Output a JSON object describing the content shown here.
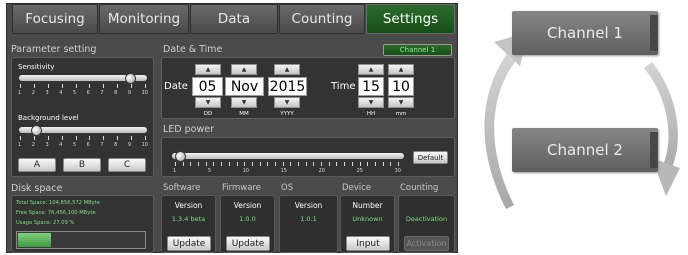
{
  "tabs": [
    {
      "label": "Focusing"
    },
    {
      "label": "Monitoring"
    },
    {
      "label": "Data"
    },
    {
      "label": "Counting"
    },
    {
      "label": "Settings",
      "active": true
    }
  ],
  "parameter": {
    "title": "Parameter setting",
    "sensitivity_label": "Sensitivity",
    "sensitivity_value": 9,
    "background_label": "Background level",
    "background_value": 2,
    "scale": [
      "1",
      "2",
      "3",
      "4",
      "5",
      "6",
      "7",
      "8",
      "9",
      "10"
    ],
    "buttons": [
      "A",
      "B",
      "C"
    ]
  },
  "datetime": {
    "title": "Date & Time",
    "channel_badge": "Channel 1",
    "date_label": "Date",
    "day": "05",
    "month": "Nov",
    "year": "2015",
    "day_sub": "DD",
    "month_sub": "MM",
    "year_sub": "YYYY",
    "time_label": "Time",
    "hour": "15",
    "minute": "10",
    "hour_sub": "HH",
    "minute_sub": "mm",
    "up_arrow": "▲",
    "down_arrow": "▼"
  },
  "led": {
    "title": "LED power",
    "value": 1,
    "scale": [
      "1",
      "5",
      "10",
      "15",
      "20",
      "25",
      "30"
    ],
    "default_button": "Default"
  },
  "disk": {
    "title": "Disk space",
    "total": "Total Space: 104,856,572 MByte",
    "free": "Free Space: 76,456,100 MByte",
    "usage": "Usage Space: 27.09 %",
    "usage_fraction": 0.27
  },
  "software": {
    "title": "Software",
    "label": "Version",
    "value": "1.3.4 beta",
    "button": "Update"
  },
  "firmware": {
    "title": "Firmware",
    "label": "Version",
    "value": "1.0.0",
    "button": "Update"
  },
  "os": {
    "title": "OS",
    "label": "Version",
    "value": "1.0.1"
  },
  "device": {
    "title": "Device",
    "label": "Number",
    "value": "Unknown",
    "button": "Input"
  },
  "counting": {
    "title": "Counting",
    "status": "Deactivation",
    "button": "Activation"
  },
  "channels": {
    "channel1": "Channel 1",
    "channel2": "Channel 2"
  },
  "colors": {
    "active_tab": "#1f5e1f",
    "accent_text": "#6fd86f",
    "panel": "#4a4a4a"
  }
}
